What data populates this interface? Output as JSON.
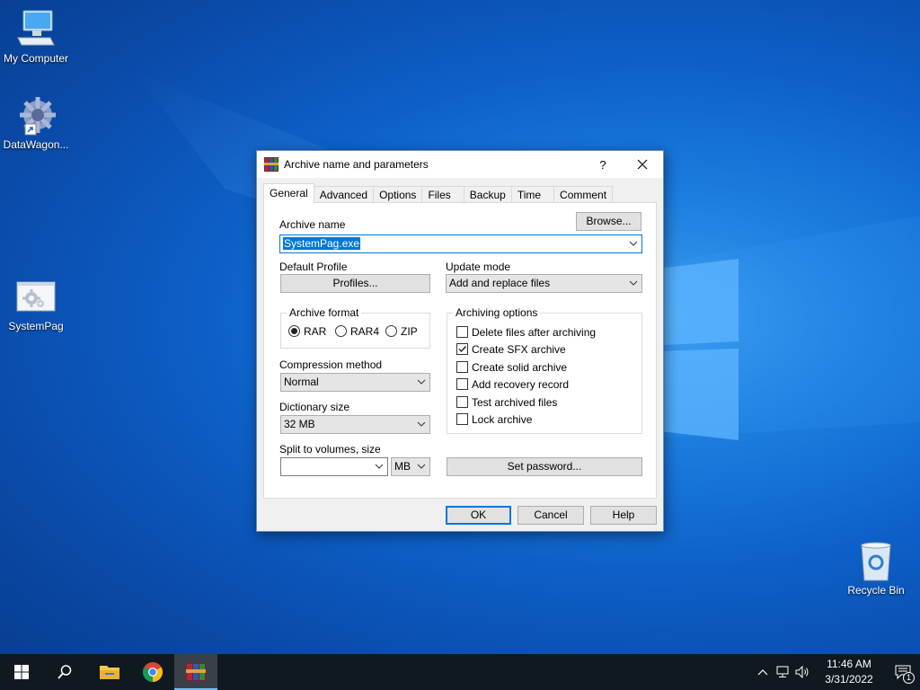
{
  "desktop": {
    "icons": [
      {
        "label": "My Computer",
        "icon": "computer-icon"
      },
      {
        "label": "DataWagon...",
        "icon": "gear-shortcut-icon"
      },
      {
        "label": "SystemPag",
        "icon": "gear-file-icon"
      },
      {
        "label": "Recycle Bin",
        "icon": "recycle-bin-icon"
      }
    ]
  },
  "dialog": {
    "title": "Archive name and parameters",
    "help": "?",
    "tabs": [
      "General",
      "Advanced",
      "Options",
      "Files",
      "Backup",
      "Time",
      "Comment"
    ],
    "active_tab": "General",
    "archive_name_label": "Archive name",
    "browse_label": "Browse...",
    "archive_name_value": "SystemPag.exe",
    "default_profile_label": "Default Profile",
    "profiles_label": "Profiles...",
    "update_mode_label": "Update mode",
    "update_mode_value": "Add and replace files",
    "archive_format_label": "Archive format",
    "formats": [
      {
        "label": "RAR",
        "selected": true
      },
      {
        "label": "RAR4",
        "selected": false
      },
      {
        "label": "ZIP",
        "selected": false
      }
    ],
    "compression_method_label": "Compression method",
    "compression_method_value": "Normal",
    "dictionary_size_label": "Dictionary size",
    "dictionary_size_value": "32 MB",
    "split_label": "Split to volumes, size",
    "split_value": "",
    "split_unit": "MB",
    "archiving_options_label": "Archiving options",
    "options": [
      {
        "label": "Delete files after archiving",
        "checked": false
      },
      {
        "label": "Create SFX archive",
        "checked": true
      },
      {
        "label": "Create solid archive",
        "checked": false
      },
      {
        "label": "Add recovery record",
        "checked": false
      },
      {
        "label": "Test archived files",
        "checked": false
      },
      {
        "label": "Lock archive",
        "checked": false
      }
    ],
    "set_password_label": "Set password...",
    "ok_label": "OK",
    "cancel_label": "Cancel",
    "help_label": "Help"
  },
  "taskbar": {
    "apps": [
      "start-icon",
      "search-icon",
      "file-explorer-icon",
      "chrome-icon",
      "winrar-icon"
    ],
    "time": "11:46 AM",
    "date": "3/31/2022",
    "notification_count": "1"
  }
}
